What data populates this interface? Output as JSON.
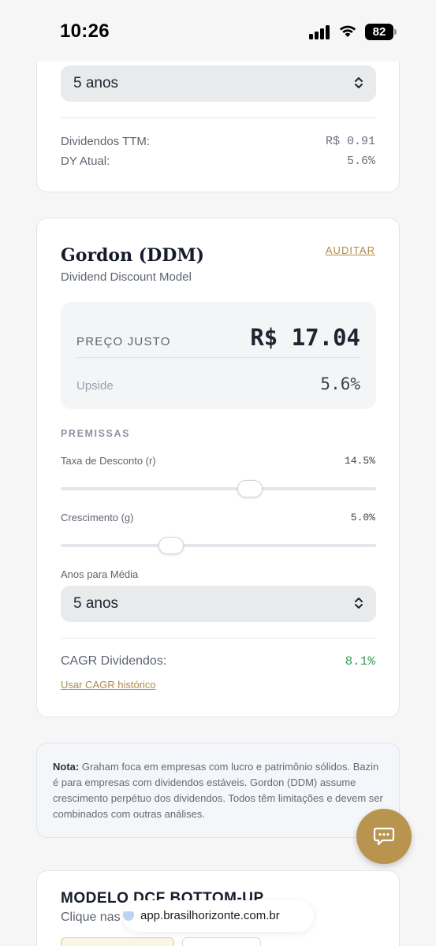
{
  "status_bar": {
    "time": "10:26",
    "battery": "82"
  },
  "dividend_card": {
    "select_value": "5 anos",
    "rows": [
      {
        "label": "Dividendos TTM:",
        "value": "R$ 0.91"
      },
      {
        "label": "DY Atual:",
        "value": "5.6%"
      }
    ]
  },
  "gordon_card": {
    "title": "Gordon (DDM)",
    "subtitle": "Dividend Discount Model",
    "audit_label": "AUDITAR",
    "price_label": "PREÇO JUSTO",
    "price_value": "R$ 17.04",
    "upside_label": "Upside",
    "upside_value": "5.6%",
    "premises_heading": "PREMISSAS",
    "discount_rate": {
      "label": "Taxa de Desconto (r)",
      "value": "14.5%",
      "slider_fraction": 0.6
    },
    "growth": {
      "label": "Crescimento (g)",
      "value": "5.0%",
      "slider_fraction": 0.35
    },
    "years_label": "Anos para Média",
    "years_select_value": "5 anos",
    "cagr_label": "CAGR Dividendos:",
    "cagr_value": "8.1%",
    "cagr_link": "Usar CAGR histórico"
  },
  "note": {
    "bold": "Nota:",
    "text": " Graham foca em empresas com lucro e patrimônio sólidos. Bazin é para empresas com dividendos estáveis. Gordon (DDM) assume crescimento perpétuo dos dividendos. Todos têm limitações e devem ser combinados com outras análises."
  },
  "dcf_card": {
    "title": "MODELO DCF BOTTOM-UP",
    "subtitle": "Clique nas"
  },
  "browser": {
    "url": "app.brasilhorizonte.com.br"
  },
  "colors": {
    "accent_gold": "#b8944f",
    "positive_green": "#3b9b54"
  }
}
